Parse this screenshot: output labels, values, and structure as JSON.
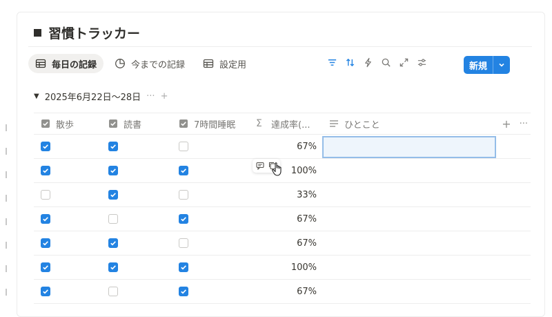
{
  "page": {
    "title": "習慣トラッカー"
  },
  "tabs": [
    {
      "label": "毎日の記録",
      "icon": "table-icon",
      "active": true
    },
    {
      "label": "今までの記録",
      "icon": "pie-chart-icon",
      "active": false
    },
    {
      "label": "設定用",
      "icon": "table-icon",
      "active": false
    }
  ],
  "toolbar": {
    "icons": [
      "filter-icon",
      "sort-icon",
      "lightning-icon",
      "search-icon",
      "expand-icon",
      "settings-sliders-icon"
    ],
    "new_label": "新規"
  },
  "group": {
    "label": "2025年6月22日～28日"
  },
  "columns": [
    {
      "label": "散歩",
      "icon": "checkbox-icon"
    },
    {
      "label": "読書",
      "icon": "checkbox-icon"
    },
    {
      "label": "7時間睡眠",
      "icon": "checkbox-icon"
    },
    {
      "label": "達成率(...",
      "icon": "sigma-icon"
    },
    {
      "label": "ひとこと",
      "icon": "text-lines-icon"
    }
  ],
  "rows": [
    {
      "walk": true,
      "read": true,
      "sleep": false,
      "rate": "67%"
    },
    {
      "walk": true,
      "read": true,
      "sleep": true,
      "rate": "100%"
    },
    {
      "walk": false,
      "read": true,
      "sleep": false,
      "rate": "33%"
    },
    {
      "walk": true,
      "read": false,
      "sleep": true,
      "rate": "67%"
    },
    {
      "walk": true,
      "read": true,
      "sleep": false,
      "rate": "67%"
    },
    {
      "walk": true,
      "read": true,
      "sleep": true,
      "rate": "100%"
    },
    {
      "walk": true,
      "read": false,
      "sleep": true,
      "rate": "67%"
    }
  ],
  "colors": {
    "accent": "#2383e2",
    "active_tab_bg": "#f1f0ee",
    "selected_cell_border": "#94bde8"
  }
}
